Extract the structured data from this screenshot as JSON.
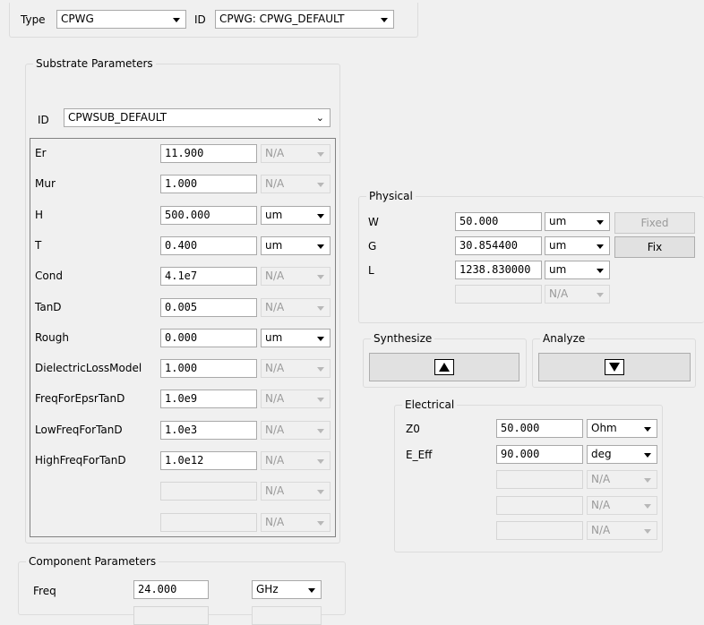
{
  "top": {
    "type_label": "Type",
    "type_value": "CPWG",
    "id_label": "ID",
    "id_value": "CPWG: CPWG_DEFAULT"
  },
  "substrate": {
    "title": "Substrate Parameters",
    "id_label": "ID",
    "id_value": "CPWSUB_DEFAULT",
    "params": [
      {
        "name": "Er",
        "value": "11.900",
        "unit": "N/A",
        "unit_enabled": false
      },
      {
        "name": "Mur",
        "value": "1.000",
        "unit": "N/A",
        "unit_enabled": false
      },
      {
        "name": "H",
        "value": "500.000",
        "unit": "um",
        "unit_enabled": true
      },
      {
        "name": "T",
        "value": "0.400",
        "unit": "um",
        "unit_enabled": true
      },
      {
        "name": "Cond",
        "value": "4.1e7",
        "unit": "N/A",
        "unit_enabled": false
      },
      {
        "name": "TanD",
        "value": "0.005",
        "unit": "N/A",
        "unit_enabled": false
      },
      {
        "name": "Rough",
        "value": "0.000",
        "unit": "um",
        "unit_enabled": true
      },
      {
        "name": "DielectricLossModel",
        "value": "1.000",
        "unit": "N/A",
        "unit_enabled": false
      },
      {
        "name": "FreqForEpsrTanD",
        "value": "1.0e9",
        "unit": "N/A",
        "unit_enabled": false
      },
      {
        "name": "LowFreqForTanD",
        "value": "1.0e3",
        "unit": "N/A",
        "unit_enabled": false
      },
      {
        "name": "HighFreqForTanD",
        "value": "1.0e12",
        "unit": "N/A",
        "unit_enabled": false
      },
      {
        "name": "",
        "value": "",
        "unit": "N/A",
        "unit_enabled": false
      },
      {
        "name": "",
        "value": "",
        "unit": "N/A",
        "unit_enabled": false
      }
    ]
  },
  "physical": {
    "title": "Physical",
    "params": [
      {
        "name": "W",
        "value": "50.000",
        "unit": "um",
        "unit_enabled": true,
        "button": "Fixed",
        "button_enabled": false
      },
      {
        "name": "G",
        "value": "30.854400",
        "unit": "um",
        "unit_enabled": true,
        "button": "Fix",
        "button_enabled": true
      },
      {
        "name": "L",
        "value": "1238.830000",
        "unit": "um",
        "unit_enabled": true,
        "button": "",
        "button_enabled": false
      },
      {
        "name": "",
        "value": "",
        "unit": "N/A",
        "unit_enabled": false,
        "button": "",
        "button_enabled": false
      }
    ]
  },
  "synthesize": {
    "title": "Synthesize"
  },
  "analyze": {
    "title": "Analyze"
  },
  "electrical": {
    "title": "Electrical",
    "params": [
      {
        "name": "Z0",
        "value": "50.000",
        "unit": "Ohm",
        "unit_enabled": true
      },
      {
        "name": "E_Eff",
        "value": "90.000",
        "unit": "deg",
        "unit_enabled": true
      },
      {
        "name": "",
        "value": "",
        "unit": "N/A",
        "unit_enabled": false
      },
      {
        "name": "",
        "value": "",
        "unit": "N/A",
        "unit_enabled": false
      },
      {
        "name": "",
        "value": "",
        "unit": "N/A",
        "unit_enabled": false
      }
    ]
  },
  "component": {
    "title": "Component Parameters",
    "params": [
      {
        "name": "Freq",
        "value": "24.000",
        "unit": "GHz",
        "unit_enabled": true
      }
    ]
  }
}
